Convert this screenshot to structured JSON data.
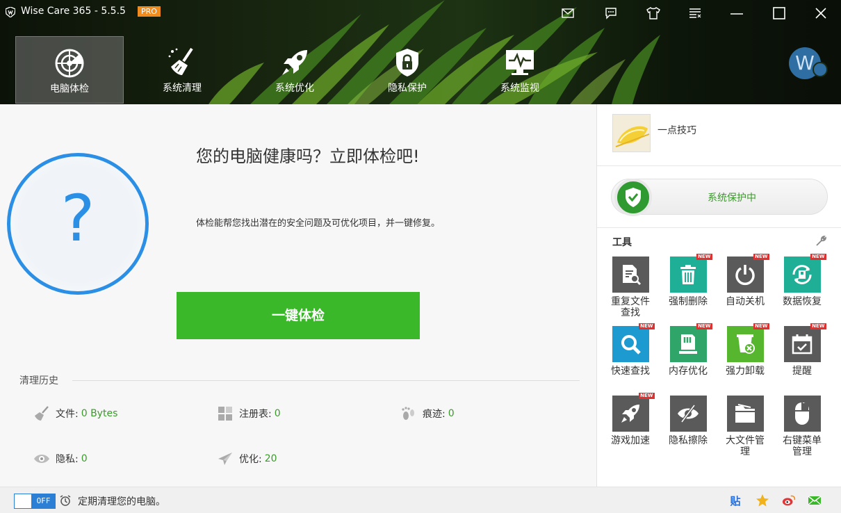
{
  "app": {
    "title": "Wise Care 365 - 5.5.5",
    "badge": "PRO",
    "user_initial": "W"
  },
  "window_controls": [
    {
      "name": "mail-icon"
    },
    {
      "name": "feedback-icon"
    },
    {
      "name": "skin-icon"
    },
    {
      "name": "menu-icon"
    },
    {
      "name": "minimize-icon"
    },
    {
      "name": "maximize-icon"
    },
    {
      "name": "close-icon"
    }
  ],
  "nav": {
    "tabs": [
      {
        "label": "电脑体检",
        "icon": "radar-icon",
        "active": true
      },
      {
        "label": "系统清理",
        "icon": "broom-icon",
        "active": false
      },
      {
        "label": "系统优化",
        "icon": "rocket-icon",
        "active": false
      },
      {
        "label": "隐私保护",
        "icon": "shield-lock-icon",
        "active": false
      },
      {
        "label": "系统监视",
        "icon": "monitor-icon",
        "active": false
      }
    ]
  },
  "main": {
    "headline": "您的电脑健康吗？立即体检吧!",
    "subline": "体检能帮您找出潜在的安全问题及可优化项目，并一键修复。",
    "check_button": "一键体检",
    "history": {
      "title": "清理历史",
      "items": [
        {
          "label": "文件:",
          "value": "0 Bytes",
          "icon": "broom-icon"
        },
        {
          "label": "注册表:",
          "value": "0",
          "icon": "registry-icon"
        },
        {
          "label": "痕迹:",
          "value": "0",
          "icon": "footprint-icon"
        },
        {
          "label": "隐私:",
          "value": "0",
          "icon": "eye-icon"
        },
        {
          "label": "优化:",
          "value": "20",
          "icon": "paper-plane-icon"
        }
      ]
    }
  },
  "right": {
    "tip_label": "一点技巧",
    "protect_status": "系统保护中",
    "tools_title": "工具",
    "tools": [
      {
        "label": "重复文件\n查找",
        "color": "#5a5a5a",
        "new": false,
        "icon": "duplicate-file-icon"
      },
      {
        "label": "强制删除",
        "color": "#1fae96",
        "new": true,
        "icon": "trash-icon"
      },
      {
        "label": "自动关机",
        "color": "#5a5a5a",
        "new": true,
        "icon": "power-icon"
      },
      {
        "label": "数据恢复",
        "color": "#1fae96",
        "new": true,
        "icon": "recover-icon"
      },
      {
        "label": "快速查找",
        "color": "#1d9bd1",
        "new": true,
        "icon": "search-icon"
      },
      {
        "label": "内存优化",
        "color": "#2fa56a",
        "new": true,
        "icon": "memory-icon"
      },
      {
        "label": "强力卸载",
        "color": "#56b62e",
        "new": true,
        "icon": "uninstall-icon"
      },
      {
        "label": "提醒",
        "color": "#5a5a5a",
        "new": true,
        "icon": "calendar-icon"
      },
      {
        "label": "游戏加速",
        "color": "#5a5a5a",
        "new": true,
        "icon": "rocket-icon"
      },
      {
        "label": "隐私擦除",
        "color": "#5a5a5a",
        "new": false,
        "icon": "eye-slash-icon"
      },
      {
        "label": "大文件管\n理",
        "color": "#5a5a5a",
        "new": false,
        "icon": "folder-icon"
      },
      {
        "label": "右键菜单\n管理",
        "color": "#5a5a5a",
        "new": false,
        "icon": "mouse-icon"
      }
    ],
    "new_badge": "NEW"
  },
  "bottom": {
    "toggle_state": "OFF",
    "schedule_text": "定期清理您的电脑。",
    "social": [
      {
        "name": "tieba-icon",
        "glyph": "贴",
        "color": "#2b6fd6"
      },
      {
        "name": "star-icon",
        "color": "#f2b21b"
      },
      {
        "name": "weibo-icon",
        "color": "#e0383a"
      },
      {
        "name": "wechat-mail-icon",
        "color": "#3bb829"
      }
    ]
  },
  "colors": {
    "accent_blue": "#2b8fe6",
    "accent_green": "#3bb829",
    "value_green": "#3a9a2a"
  }
}
